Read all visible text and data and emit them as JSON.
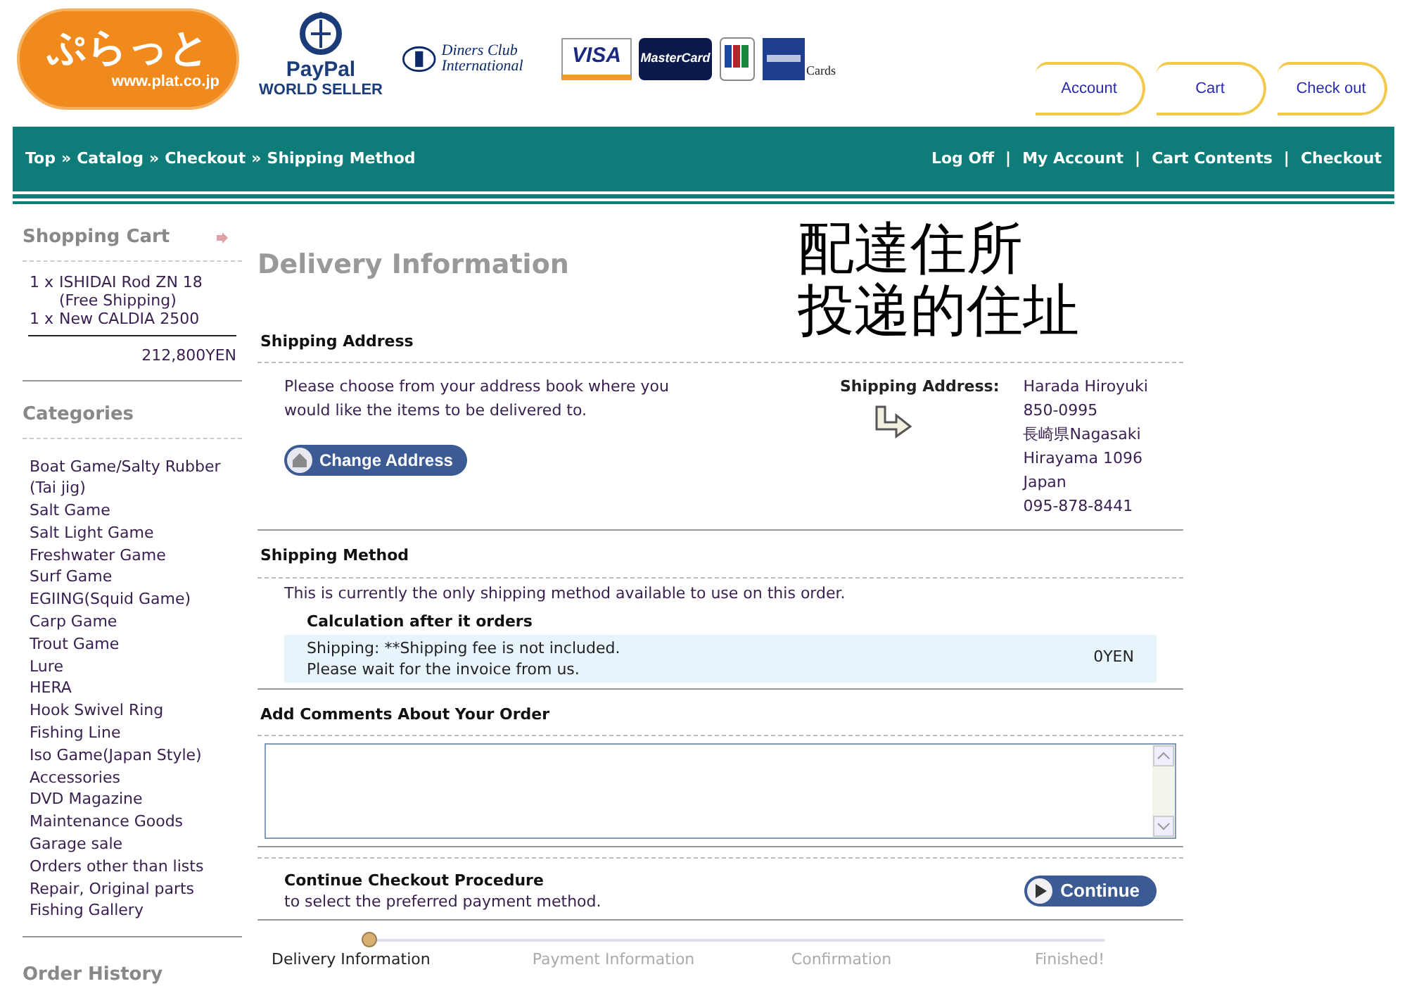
{
  "header": {
    "shop_logo": {
      "name": "ぷらっと",
      "url": "www.plat.co.jp"
    },
    "paypal": {
      "name": "PayPal",
      "badge": "WORLD SELLER"
    },
    "cards": {
      "diners": "Diners Club International",
      "visa": "VISA",
      "mastercard": "MasterCard",
      "caption": "Cards"
    },
    "tabs": [
      "Account",
      "Cart",
      "Check out"
    ]
  },
  "nav_bar": {
    "separator": "»",
    "link_separator": "|",
    "breadcrumb": [
      "Top",
      "Catalog",
      "Checkout",
      "Shipping Method"
    ],
    "links": [
      "Log Off",
      "My Account",
      "Cart Contents",
      "Checkout"
    ]
  },
  "sidebar": {
    "cart": {
      "title": "Shopping Cart",
      "items": [
        {
          "qty": "1 x",
          "name": "ISHIDAI Rod ZN 18",
          "note": "(Free Shipping)"
        },
        {
          "qty": "1 x",
          "name": "New CALDIA 2500"
        }
      ],
      "total": "212,800YEN"
    },
    "categories": {
      "title": "Categories",
      "items": [
        "Boat Game/Salty Rubber (Tai jig)",
        "Salt Game",
        "Salt Light Game",
        "Freshwater Game",
        "Surf Game",
        "EGIING(Squid Game)",
        "Carp Game",
        "Trout Game",
        "Lure",
        "HERA",
        "Hook Swivel Ring",
        "Fishing Line",
        "Iso Game(Japan Style)",
        "Accessories",
        "DVD Magazine",
        "Maintenance Goods",
        "Garage sale",
        "Orders other than lists",
        "Repair, Original parts",
        "Fishing Gallery"
      ]
    },
    "order_history": {
      "title": "Order History"
    }
  },
  "annotation": [
    "配達住所",
    "投递的住址"
  ],
  "main": {
    "title": "Delivery Information",
    "shipping_address": {
      "heading": "Shipping Address",
      "text": "Please choose from your address book where you would like the items to be delivered to.",
      "button": "Change Address",
      "label": "Shipping Address:",
      "lines": [
        "Harada Hiroyuki",
        "850-0995",
        "長崎県Nagasaki",
        "Hirayama 1096",
        "Japan",
        "095-878-8441"
      ]
    },
    "shipping_method": {
      "heading": "Shipping Method",
      "text": "This is currently the only shipping method available to use on this order.",
      "option_title": "Calculation after it orders",
      "option_lines": [
        "Shipping: **Shipping fee is not included.",
        "Please wait for the invoice from us."
      ],
      "price": "0YEN"
    },
    "comments": {
      "heading": "Add Comments About Your Order"
    },
    "continue": {
      "title": "Continue Checkout Procedure",
      "text": "to select the preferred payment method.",
      "button": "Continue"
    },
    "steps": [
      {
        "label": "Delivery Information",
        "selected": true
      },
      {
        "label": "Payment Information",
        "selected": false
      },
      {
        "label": "Confirmation",
        "selected": false
      },
      {
        "label": "Finished!",
        "selected": false
      }
    ]
  }
}
